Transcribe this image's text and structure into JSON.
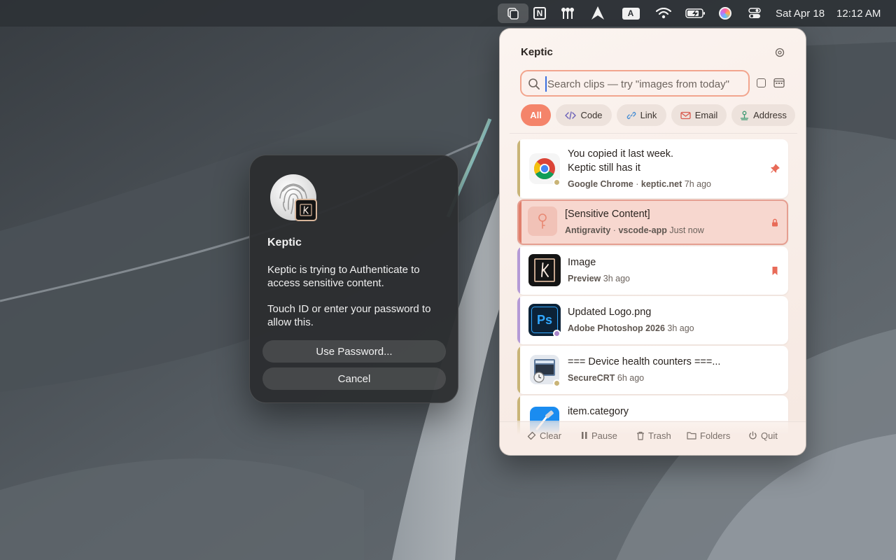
{
  "menubar": {
    "date": "Sat Apr 18",
    "time": "12:12 AM",
    "icons": [
      "clipboard-icon",
      "notion-icon",
      "tool-icon",
      "arrow-icon",
      "input-source-icon",
      "wifi-icon",
      "battery-icon",
      "siri-icon",
      "control-center-icon"
    ],
    "notion_glyph": "N",
    "input_source_glyph": "A"
  },
  "auth": {
    "title": "Keptic",
    "message1": "Keptic is trying to Authenticate to access sensitive content.",
    "message2": "Touch ID or enter your password to allow this.",
    "use_password_label": "Use Password...",
    "cancel_label": "Cancel"
  },
  "panel": {
    "title": "Keptic",
    "search_placeholder": "Search clips — try \"images from today\"",
    "chips": {
      "all": "All",
      "code": "Code",
      "link": "Link",
      "email": "Email",
      "address": "Address"
    },
    "clips": [
      {
        "title_line1": "You copied it last week.",
        "title_line2": "Keptic still has it",
        "app": "Google Chrome",
        "sep": "·",
        "source": "keptic.net",
        "time": "7h ago",
        "right_icon": "pin-icon"
      },
      {
        "title": "[Sensitive Content]",
        "app": "Antigravity",
        "sep": "·",
        "source": "vscode-app",
        "time": "Just now",
        "right_icon": "lock-icon"
      },
      {
        "title": "Image",
        "app": "Preview",
        "time": "3h ago",
        "right_icon": "bookmark-icon"
      },
      {
        "title": "Updated Logo.png",
        "app": "Adobe Photoshop 2026",
        "time": "3h ago",
        "ps_glyph": "Ps"
      },
      {
        "title": "=== Device health counters ===...",
        "app": "SecureCRT",
        "time": "6h ago"
      },
      {
        "title": "item.category"
      }
    ],
    "footer": {
      "clear": "Clear",
      "pause": "Pause",
      "trash": "Trash",
      "folders": "Folders",
      "quit": "Quit"
    }
  },
  "colors": {
    "accent": "#f4846a",
    "clip_accent_gold": "#c9b477",
    "clip_accent_purple": "#b59ad6",
    "sensitive_bg": "#f7d7cf"
  }
}
